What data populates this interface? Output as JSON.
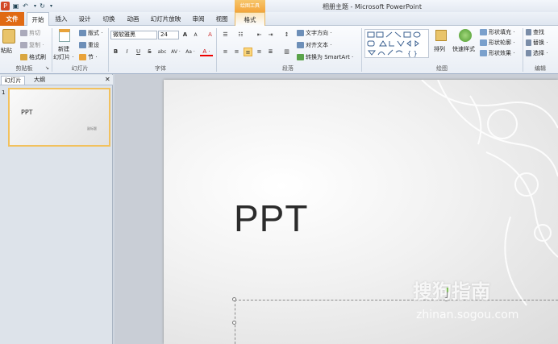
{
  "app": {
    "title": "相册主题 - Microsoft PowerPoint",
    "context_tools": "绘图工具"
  },
  "tabs": [
    "文件",
    "开始",
    "插入",
    "设计",
    "切换",
    "动画",
    "幻灯片放映",
    "审阅",
    "视图",
    "格式"
  ],
  "clipboard": {
    "paste": "粘贴",
    "cut": "剪切",
    "copy": "复制 ·",
    "format_painter": "格式刷",
    "label": "剪贴板"
  },
  "slides_group": {
    "new_slide": "新建",
    "new_slide2": "幻灯片 ·",
    "layout": "版式 ·",
    "reset": "重设",
    "section": "节 ·",
    "label": "幻灯片"
  },
  "font_group": {
    "font_name": "微软雅黑",
    "font_size": "24",
    "grow": "A",
    "shrink": "A",
    "clear": "A",
    "bold": "B",
    "italic": "I",
    "underline": "U",
    "strike": "S",
    "shadow": "abc",
    "spacing": "AV ·",
    "case": "Aa ·",
    "color": "A ·",
    "label": "字体"
  },
  "paragraph_group": {
    "text_direction": "文字方向 ·",
    "align_text": "对齐文本 ·",
    "smartart": "转换为 SmartArt ·",
    "label": "段落"
  },
  "drawing_group": {
    "arrange": "排列",
    "quick_styles": "快速样式",
    "shape_fill": "形状填充 ·",
    "shape_outline": "形状轮廓 ·",
    "shape_effects": "形状效果 ·",
    "label": "绘图"
  },
  "editing_group": {
    "find": "查找",
    "replace": "替换 ·",
    "select": "选择 ·",
    "label": "编辑"
  },
  "panel": {
    "tab_slides": "幻灯片",
    "tab_outline": "大纲",
    "close": "✕",
    "slide_number": "1",
    "thumb_title": "PPT",
    "thumb_sub": "副标题"
  },
  "slide": {
    "title": "PPT"
  },
  "watermark": {
    "text": "搜狗指南",
    "url": "zhinan.sogou.com"
  },
  "colors": {
    "file_tab": "#e06a14",
    "accent": "#f2c15d",
    "ribbon_bg": "#fbfcfe"
  }
}
